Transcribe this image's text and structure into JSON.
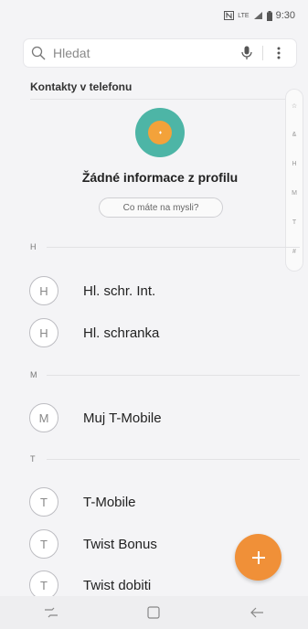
{
  "status_bar": {
    "time": "9:30",
    "nfc_icon": "nfc-icon",
    "network_label": "LTE",
    "signal_icon": "signal-icon",
    "battery_icon": "battery-icon"
  },
  "search": {
    "placeholder": "Hledat",
    "search_icon": "search-icon",
    "mic_icon": "mic-icon",
    "more_icon": "more-vert-icon"
  },
  "section": {
    "title": "Kontakty v telefonu"
  },
  "profile": {
    "title": "Žádné informace z profilu",
    "button_label": "Co máte na mysli?",
    "avatar_color": "#4db5a6",
    "avatar_inner_color": "#f3a23a"
  },
  "index_scroller": {
    "items": [
      "☆",
      "&",
      "H",
      "M",
      "T",
      "#"
    ]
  },
  "contact_groups": [
    {
      "letter": "H",
      "contacts": [
        {
          "initial": "H",
          "name": "Hl. schr. Int."
        },
        {
          "initial": "H",
          "name": "Hl. schranka"
        }
      ]
    },
    {
      "letter": "M",
      "contacts": [
        {
          "initial": "M",
          "name": "Muj T-Mobile"
        }
      ]
    },
    {
      "letter": "T",
      "contacts": [
        {
          "initial": "T",
          "name": "T-Mobile"
        },
        {
          "initial": "T",
          "name": "Twist Bonus"
        },
        {
          "initial": "T",
          "name": "Twist dobiti"
        }
      ]
    }
  ],
  "fab": {
    "icon": "plus-icon",
    "color": "#f09038"
  },
  "nav_bar": {
    "recent_icon": "recent-apps-icon",
    "home_icon": "home-icon",
    "back_icon": "back-arrow-icon"
  }
}
